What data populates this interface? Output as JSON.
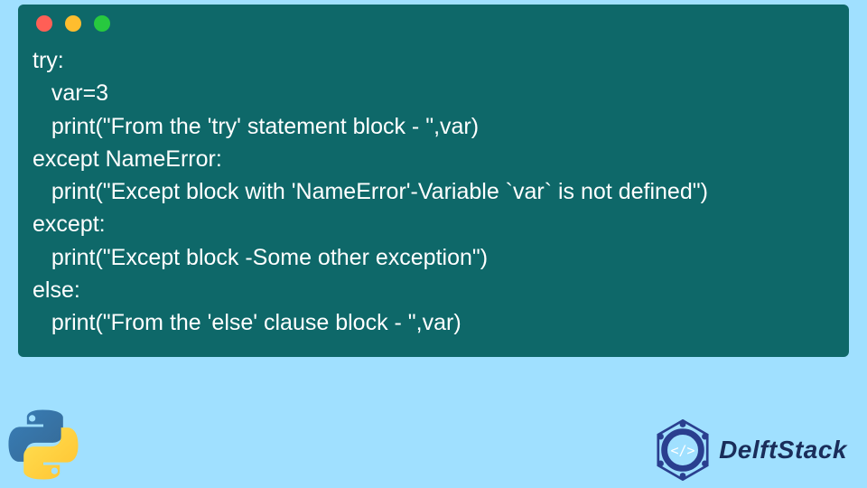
{
  "window_controls": {
    "red": "#ff5f56",
    "yellow": "#ffbd2e",
    "green": "#27c93f"
  },
  "code": {
    "lines": [
      "try:",
      "   var=3",
      "   print(\"From the 'try' statement block - \",var)",
      "except NameError:",
      "   print(\"Except block with 'NameError'-Variable `var` is not defined\")",
      "except:",
      "   print(\"Except block -Some other exception\")",
      "else:",
      "   print(\"From the 'else' clause block - \",var)"
    ]
  },
  "footer": {
    "python_icon": "python-logo",
    "brand_icon": "delftstack-badge",
    "brand_text": "DelftStack"
  }
}
